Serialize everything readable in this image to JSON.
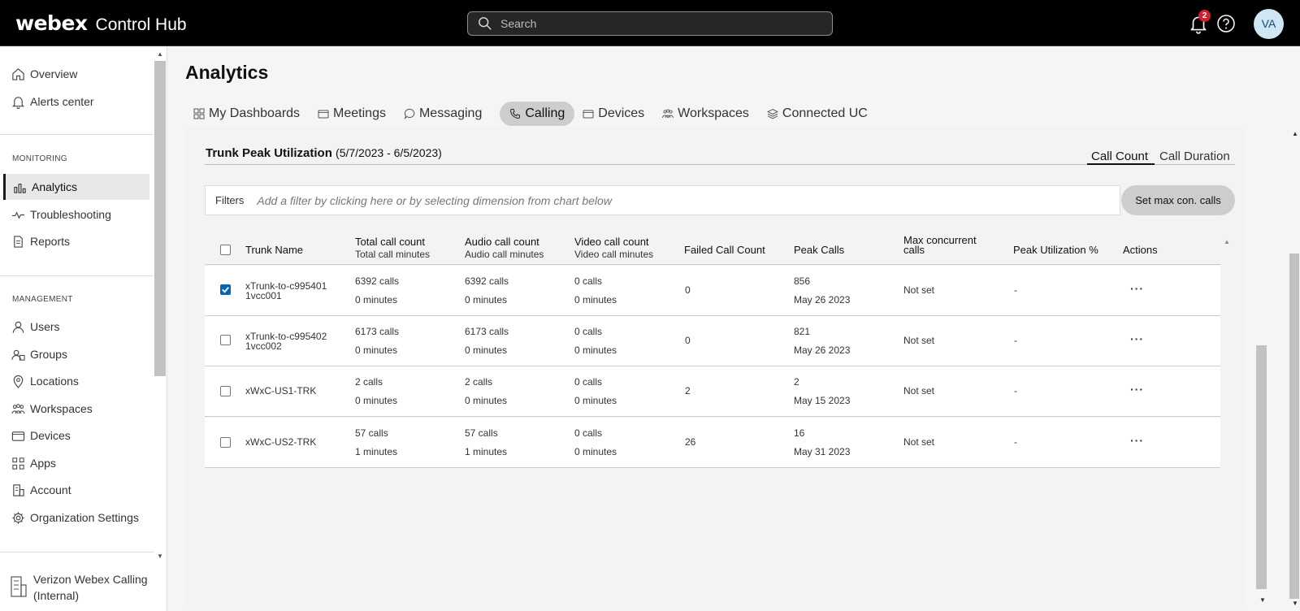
{
  "header": {
    "brand_logo": "webex",
    "brand_product": "Control Hub",
    "search_placeholder": "Search",
    "notification_count": "2",
    "avatar_initials": "VA"
  },
  "sidebar": {
    "top_items": [
      {
        "label": "Overview",
        "icon": "home-icon"
      },
      {
        "label": "Alerts center",
        "icon": "bell-icon"
      }
    ],
    "monitoring_label": "MONITORING",
    "monitoring_items": [
      {
        "label": "Analytics",
        "icon": "bar-chart-icon",
        "active": true
      },
      {
        "label": "Troubleshooting",
        "icon": "pulse-icon"
      },
      {
        "label": "Reports",
        "icon": "document-icon"
      }
    ],
    "management_label": "MANAGEMENT",
    "management_items": [
      {
        "label": "Users",
        "icon": "user-icon"
      },
      {
        "label": "Groups",
        "icon": "groups-icon"
      },
      {
        "label": "Locations",
        "icon": "location-pin-icon"
      },
      {
        "label": "Workspaces",
        "icon": "workspaces-icon"
      },
      {
        "label": "Devices",
        "icon": "devices-icon"
      },
      {
        "label": "Apps",
        "icon": "apps-grid-icon"
      },
      {
        "label": "Account",
        "icon": "building-icon"
      },
      {
        "label": "Organization Settings",
        "icon": "gear-icon"
      }
    ],
    "org_line1": "Verizon Webex Calling",
    "org_line2": "(Internal)"
  },
  "page": {
    "title": "Analytics",
    "tabs": [
      {
        "label": "My Dashboards",
        "icon": "dashboard-icon"
      },
      {
        "label": "Meetings",
        "icon": "meetings-icon"
      },
      {
        "label": "Messaging",
        "icon": "chat-bubble-icon"
      },
      {
        "label": "Calling",
        "icon": "phone-icon",
        "active": true
      },
      {
        "label": "Devices",
        "icon": "devices-icon"
      },
      {
        "label": "Workspaces",
        "icon": "workspaces-icon"
      },
      {
        "label": "Connected UC",
        "icon": "layers-icon"
      }
    ]
  },
  "panel": {
    "title": "Trunk Peak Utilization",
    "range": "(5/7/2023 - 6/5/2023)",
    "toggle_call_count": "Call Count",
    "toggle_call_duration": "Call Duration",
    "filters_label": "Filters",
    "filters_hint": "Add a filter by clicking here or by selecting dimension from chart below",
    "set_max_button": "Set max con. calls"
  },
  "table": {
    "headers": {
      "trunk_name": "Trunk Name",
      "total_call_count": "Total call count",
      "total_call_minutes": "Total call minutes",
      "audio_call_count": "Audio call count",
      "audio_call_minutes": "Audio call minutes",
      "video_call_count": "Video call count",
      "video_call_minutes": "Video call minutes",
      "failed_call_count": "Failed Call Count",
      "peak_calls": "Peak Calls",
      "max_concurrent_1": "Max concurrent",
      "max_concurrent_2": "calls",
      "peak_utilization": "Peak Utilization %",
      "actions": "Actions"
    },
    "rows": [
      {
        "checked": true,
        "name1": "xTrunk-to-c995401",
        "name2": "1vcc001",
        "total_calls": "6392 calls",
        "total_min": "0 minutes",
        "audio_calls": "6392 calls",
        "audio_min": "0 minutes",
        "video_calls": "0 calls",
        "video_min": "0 minutes",
        "failed": "0",
        "peak": "856",
        "peak_date": "May 26 2023",
        "max_conc": "Not set",
        "util": "-",
        "actions": "···"
      },
      {
        "checked": false,
        "name1": "xTrunk-to-c995402",
        "name2": "1vcc002",
        "total_calls": "6173 calls",
        "total_min": "0 minutes",
        "audio_calls": "6173 calls",
        "audio_min": "0 minutes",
        "video_calls": "0 calls",
        "video_min": "0 minutes",
        "failed": "0",
        "peak": "821",
        "peak_date": "May 26 2023",
        "max_conc": "Not set",
        "util": "-",
        "actions": "···"
      },
      {
        "checked": false,
        "name1": "xWxC-US1-TRK",
        "name2": "",
        "total_calls": "2 calls",
        "total_min": "0 minutes",
        "audio_calls": "2 calls",
        "audio_min": "0 minutes",
        "video_calls": "0 calls",
        "video_min": "0 minutes",
        "failed": "2",
        "peak": "2",
        "peak_date": "May 15 2023",
        "max_conc": "Not set",
        "util": "-",
        "actions": "···"
      },
      {
        "checked": false,
        "name1": "xWxC-US2-TRK",
        "name2": "",
        "total_calls": "57 calls",
        "total_min": "1 minutes",
        "audio_calls": "57 calls",
        "audio_min": "1 minutes",
        "video_calls": "0 calls",
        "video_min": "0 minutes",
        "failed": "26",
        "peak": "16",
        "peak_date": "May 31 2023",
        "max_conc": "Not set",
        "util": "-",
        "actions": "···"
      }
    ]
  }
}
